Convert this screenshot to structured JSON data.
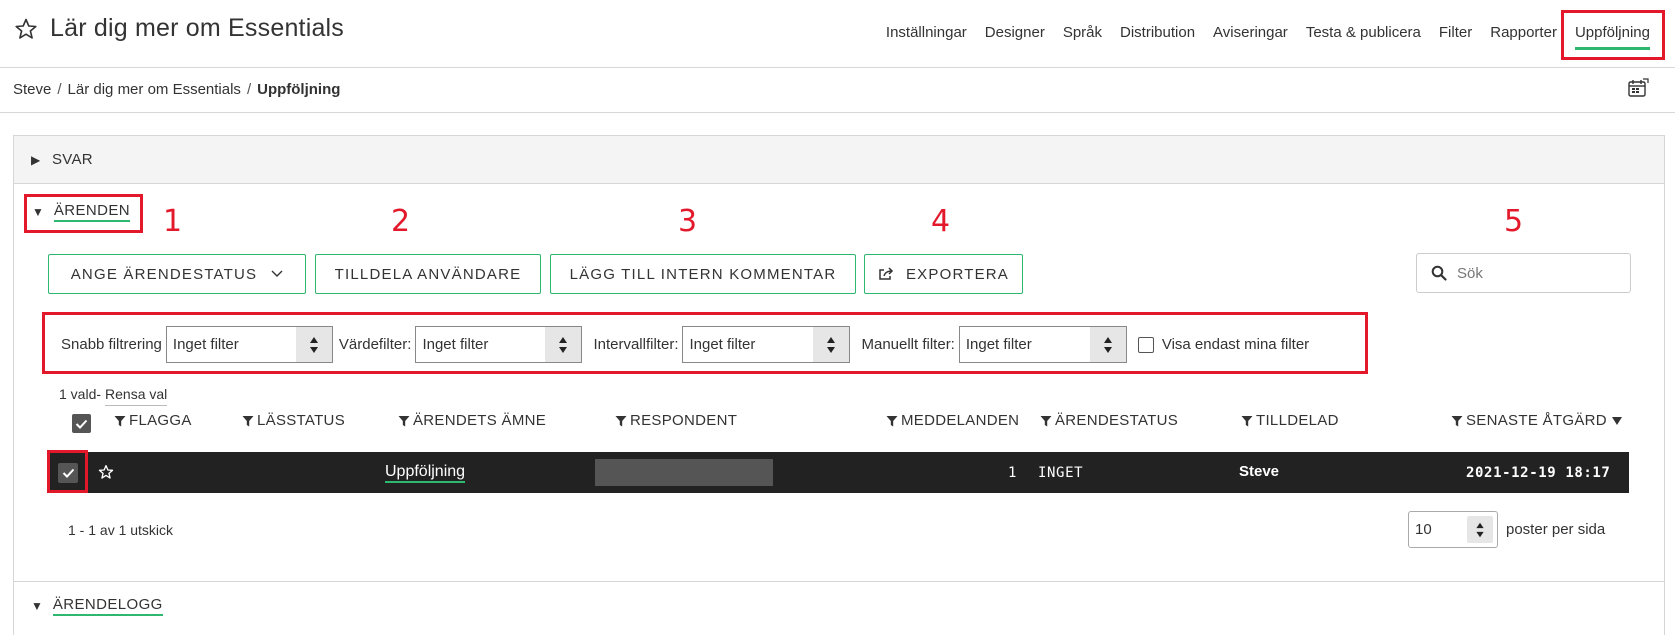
{
  "header": {
    "title": "Lär dig mer om Essentials",
    "nav": [
      "Inställningar",
      "Designer",
      "Språk",
      "Distribution",
      "Aviseringar",
      "Testa & publicera",
      "Filter",
      "Rapporter",
      "Uppföljning"
    ],
    "active_nav": "Uppföljning"
  },
  "breadcrumb": {
    "items": [
      "Steve",
      "Lär dig mer om Essentials"
    ],
    "current": "Uppföljning"
  },
  "sections": {
    "svar": "SVAR",
    "arenden": "ÄRENDEN",
    "arendelogg": "ÄRENDELOGG"
  },
  "callouts": [
    "1",
    "2",
    "3",
    "4",
    "5"
  ],
  "actions": {
    "status": "ANGE ÄRENDESTATUS",
    "assign": "TILLDELA ANVÄNDARE",
    "comment": "LÄGG TILL INTERN KOMMENTAR",
    "export": "EXPORTERA"
  },
  "search": {
    "placeholder": "Sök"
  },
  "filters": {
    "quick": {
      "label": "Snabb filtrering",
      "value": "Inget filter"
    },
    "value": {
      "label": "Värdefilter:",
      "value": "Inget filter"
    },
    "interval": {
      "label": "Intervallfilter:",
      "value": "Inget filter"
    },
    "manual": {
      "label": "Manuellt filter:",
      "value": "Inget filter"
    },
    "only_mine": "Visa endast mina filter"
  },
  "selection": {
    "count_text": "1 vald-",
    "clear": "Rensa val"
  },
  "table": {
    "columns": [
      "FLAGGA",
      "LÄSSTATUS",
      "ÄRENDETS ÄMNE",
      "RESPONDENT",
      "MEDDELANDEN",
      "ÄRENDESTATUS",
      "TILLDELAD",
      "SENASTE ÅTGÄRD"
    ],
    "rows": [
      {
        "subject": "Uppföljning",
        "messages": "1",
        "status": "INGET",
        "assigned": "Steve",
        "last_action": "2021-12-19 18:17"
      }
    ]
  },
  "pagination": {
    "summary": "1 - 1 av 1 utskick",
    "per_page_value": "10",
    "per_page_label": "poster per sida"
  },
  "colors": {
    "accent": "#2eb86f",
    "annotation": "#e3192b",
    "row_bg": "#222222"
  }
}
